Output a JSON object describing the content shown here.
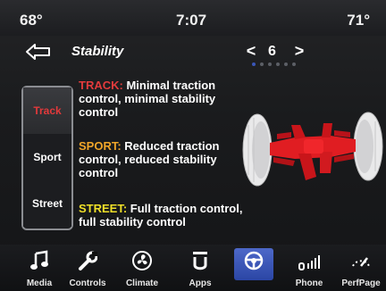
{
  "status": {
    "temp_left": "68°",
    "time": "7:07",
    "temp_right": "71°"
  },
  "header": {
    "title": "Stability",
    "page_number": "6",
    "page_dot_count": 6,
    "active_page_dot": 0
  },
  "modes": [
    {
      "label": "Track",
      "selected": true
    },
    {
      "label": "Sport",
      "selected": false
    },
    {
      "label": "Street",
      "selected": false
    }
  ],
  "descriptions": {
    "track": {
      "label": "TRACK:",
      "text": " Minimal traction control, minimal stability control"
    },
    "sport": {
      "label": "SPORT:",
      "text": " Reduced traction control, reduced stability control"
    },
    "street": {
      "label": "STREET:",
      "text": " Full traction control, full stability control"
    }
  },
  "nav": [
    {
      "label": "Media",
      "icon": "music-note-icon"
    },
    {
      "label": "Controls",
      "icon": "wrench-icon"
    },
    {
      "label": "Climate",
      "icon": "climate-fan-icon"
    },
    {
      "label": "Apps",
      "icon": "apps-icon"
    },
    {
      "label": "",
      "icon": "steering-wheel-icon",
      "active": true
    },
    {
      "label": "Phone",
      "icon": "phone-signal-icon"
    },
    {
      "label": "PerfPage",
      "icon": "performance-icon"
    }
  ],
  "colors": {
    "track": "#e23b3c",
    "sport": "#f0a529",
    "street": "#f0e028",
    "active_nav": "#3a56b8"
  }
}
